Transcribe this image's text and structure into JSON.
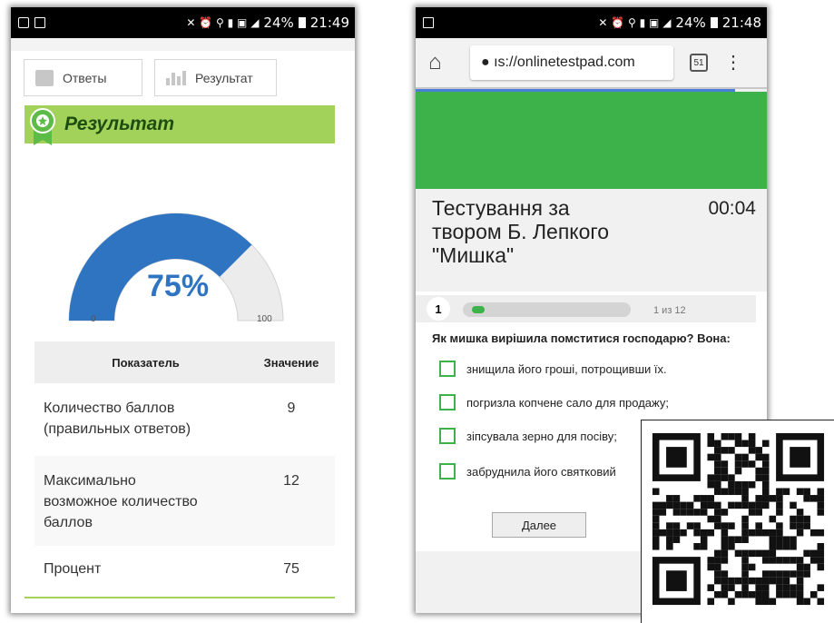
{
  "left_phone": {
    "status": {
      "signal": "24%",
      "time": "21:49"
    },
    "tabs": {
      "answers": "Ответы",
      "result": "Результат"
    },
    "banner_title": "Результат",
    "gauge": {
      "value_label": "75%",
      "fraction": 0.75,
      "min_label": "0",
      "max_label": "100",
      "color": "#2f74c0"
    },
    "table": {
      "headers": [
        "Показатель",
        "Значение"
      ],
      "rows": [
        {
          "label_lines": [
            "Количество баллов",
            "(правильных ответов)"
          ],
          "value": "9"
        },
        {
          "label_lines": [
            "Максимально",
            "возможное количество",
            "баллов"
          ],
          "value": "12"
        },
        {
          "label_lines": [
            "Процент"
          ],
          "value": "75"
        }
      ]
    }
  },
  "right_phone": {
    "status": {
      "signal": "24%",
      "time": "21:48"
    },
    "browser": {
      "url": "● ıs://onlinetestpad.com",
      "tabs_count": "51"
    },
    "title_lines": [
      "Тестування за",
      "твором Б. Лепкого",
      "\"Мишка\""
    ],
    "timer": "00:04",
    "question_number": "1",
    "progress_fraction": 0.083,
    "question_counter": "1 из 12",
    "question": "Як мишка вирішила помститися господарю? Вона:",
    "options": [
      "знищила його гроші, потрощивши їх.",
      "погризла копчене сало для продажу;",
      "зіпсувала зерно для посіву;",
      "забруднила його святковий"
    ],
    "next_button": "Далее"
  },
  "colors": {
    "accent_green": "#3db24a",
    "banner_green": "#a3d25a",
    "gauge_blue": "#2f74c0"
  }
}
